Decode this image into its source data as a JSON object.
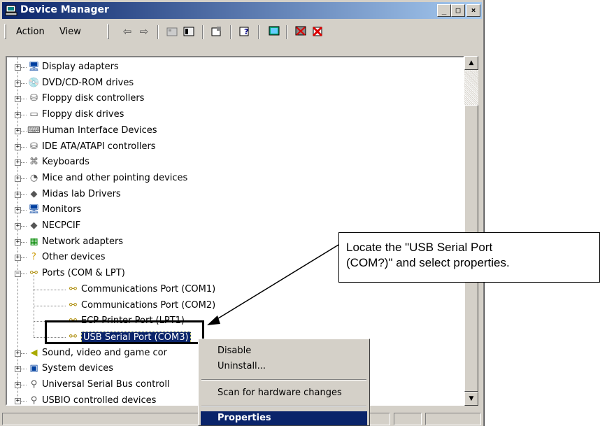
{
  "window": {
    "title": "Device Manager"
  },
  "window_controls": {
    "minimize": "_",
    "maximize": "□",
    "close": "×"
  },
  "menu": {
    "action": "Action",
    "view": "View"
  },
  "toolbar": {
    "icons": [
      "back-icon",
      "forward-icon",
      "properties-icon",
      "refresh-icon",
      "print-icon",
      "help-icon",
      "scan-icon",
      "uninstall-icon",
      "disable-icon"
    ]
  },
  "tree": {
    "items": [
      {
        "label": "Display adapters",
        "icon": "display-icon"
      },
      {
        "label": "DVD/CD-ROM drives",
        "icon": "cdrom-icon"
      },
      {
        "label": "Floppy disk controllers",
        "icon": "controller-icon"
      },
      {
        "label": "Floppy disk drives",
        "icon": "floppy-icon"
      },
      {
        "label": "Human Interface Devices",
        "icon": "hid-icon"
      },
      {
        "label": "IDE ATA/ATAPI controllers",
        "icon": "controller-icon"
      },
      {
        "label": "Keyboards",
        "icon": "keyboard-icon"
      },
      {
        "label": "Mice and other pointing devices",
        "icon": "mouse-icon"
      },
      {
        "label": "Midas lab Drivers",
        "icon": "diamond-icon"
      },
      {
        "label": "Monitors",
        "icon": "monitor-icon"
      },
      {
        "label": "NECPCIF",
        "icon": "diamond-icon"
      },
      {
        "label": "Network adapters",
        "icon": "network-icon"
      },
      {
        "label": "Other devices",
        "icon": "question-icon"
      },
      {
        "label": "Ports (COM & LPT)",
        "icon": "port-icon"
      }
    ],
    "ports_children": [
      {
        "label": "Communications Port (COM1)"
      },
      {
        "label": "Communications Port (COM2)"
      },
      {
        "label": "ECP Printer Port (LPT1)"
      },
      {
        "label": "USB Serial Port (COM3)"
      }
    ],
    "after_items": [
      {
        "label": "Sound, video and game cor",
        "icon": "sound-icon"
      },
      {
        "label": "System devices",
        "icon": "system-icon"
      },
      {
        "label": "Universal Serial Bus controll",
        "icon": "usb-icon"
      },
      {
        "label": "USBIO controlled devices",
        "icon": "usb-icon"
      }
    ],
    "expand_symbol": "+",
    "collapse_symbol": "−"
  },
  "context_menu": {
    "disable": "Disable",
    "uninstall": "Uninstall...",
    "scan": "Scan for hardware changes",
    "properties": "Properties"
  },
  "callout": {
    "line1": "Locate the \"USB Serial Port",
    "line2": "(COM?)\" and select properties."
  },
  "colors": {
    "title_active": "#0a246a",
    "selection": "#0a246a",
    "face": "#d4d0c8"
  }
}
